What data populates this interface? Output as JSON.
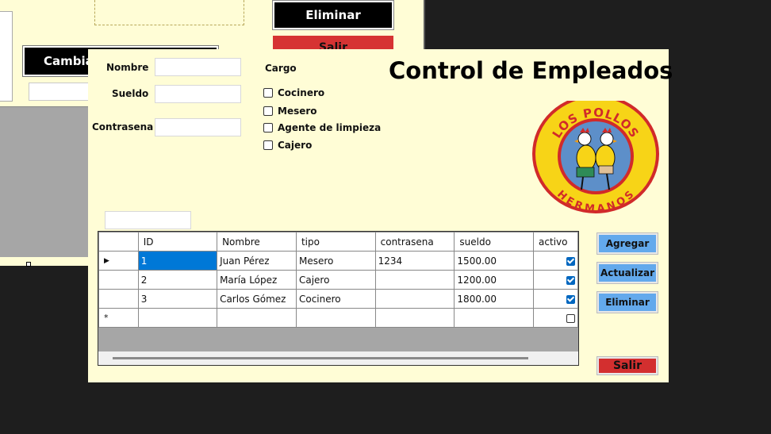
{
  "background_window": {
    "eliminar_label": "Eliminar",
    "salir_label": "Salir",
    "cambiar_label": "Cambia"
  },
  "form": {
    "title": "Control de Empleados",
    "fields": {
      "nombre_label": "Nombre",
      "sueldo_label": "Sueldo",
      "contrasena_label": "Contrasena",
      "nombre_value": "",
      "sueldo_value": "",
      "contrasena_value": ""
    },
    "cargo": {
      "label": "Cargo",
      "options": [
        {
          "label": "Cocinero",
          "checked": false
        },
        {
          "label": "Mesero",
          "checked": false
        },
        {
          "label": "Agente de limpieza",
          "checked": false
        },
        {
          "label": "Cajero",
          "checked": false
        }
      ]
    },
    "logo": {
      "top_text": "LOS POLLOS",
      "bottom_text": "HERMANOS",
      "colors": {
        "yellow": "#f7d417",
        "red": "#d12a2a",
        "blue": "#5d8fc9"
      }
    },
    "grid": {
      "columns": [
        "ID",
        "Nombre",
        "tipo",
        "contrasena",
        "sueldo",
        "activo"
      ],
      "rows": [
        {
          "id": "1",
          "nombre": "Juan Pérez",
          "tipo": "Mesero",
          "contrasena": "1234",
          "sueldo": "1500.00",
          "activo": true
        },
        {
          "id": "2",
          "nombre": "María López",
          "tipo": "Cajero",
          "contrasena": "",
          "sueldo": "1200.00",
          "activo": true
        },
        {
          "id": "3",
          "nombre": "Carlos Gómez",
          "tipo": "Cocinero",
          "contrasena": "",
          "sueldo": "1800.00",
          "activo": true
        }
      ],
      "new_row_marker": "*",
      "current_row_marker": "▶",
      "new_row_activo": false
    },
    "buttons": {
      "agregar": "Agregar",
      "actualizar": "Actualizar",
      "eliminar": "Eliminar",
      "salir": "Salir"
    },
    "colors": {
      "form_bg": "#fffdd6",
      "button_blue": "#63a9ec",
      "button_red": "#d32f2f",
      "selection": "#0078d7"
    }
  }
}
